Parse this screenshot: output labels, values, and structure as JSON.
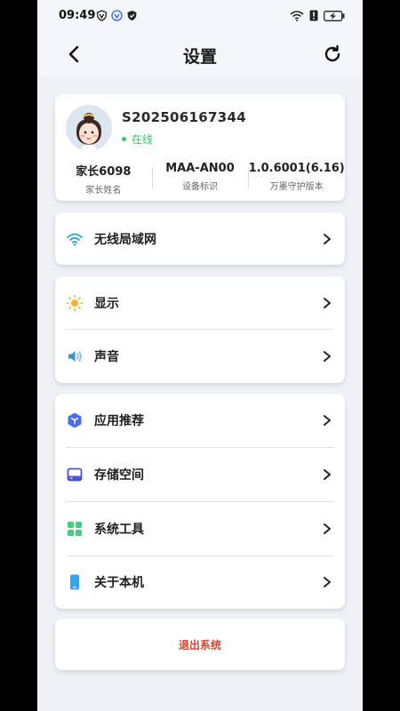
{
  "statusbar": {
    "time": "09:49"
  },
  "navbar": {
    "title": "设置"
  },
  "profile": {
    "user_id": "S202506167344",
    "status": "在线",
    "stats": [
      {
        "value": "家长6098",
        "label": "家长姓名"
      },
      {
        "value": "MAA-AN00",
        "label": "设备标识"
      },
      {
        "value": "1.0.6001(6.16)",
        "label": "万墨守护版本"
      }
    ]
  },
  "groups": {
    "network": {
      "wifi_label": "无线局域网"
    },
    "display_sound": {
      "display_label": "显示",
      "sound_label": "声音"
    },
    "apps": {
      "recommend_label": "应用推荐",
      "storage_label": "存储空间",
      "tools_label": "系统工具",
      "about_label": "关于本机"
    }
  },
  "logout_label": "退出系统",
  "colors": {
    "online": "#36c46a",
    "logout": "#d04a32",
    "background": "#eef0f5"
  }
}
